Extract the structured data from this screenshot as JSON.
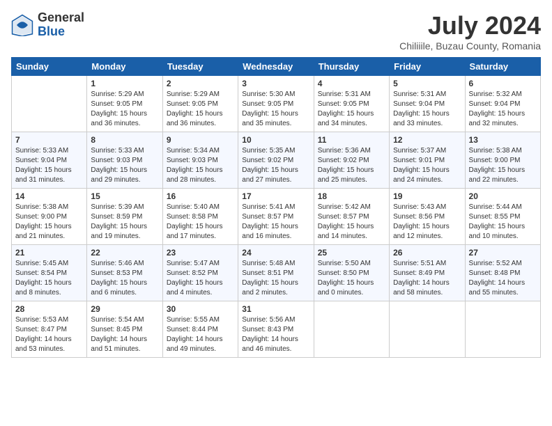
{
  "header": {
    "logo_general": "General",
    "logo_blue": "Blue",
    "month_title": "July 2024",
    "location": "Chiliiile, Buzau County, Romania"
  },
  "weekdays": [
    "Sunday",
    "Monday",
    "Tuesday",
    "Wednesday",
    "Thursday",
    "Friday",
    "Saturday"
  ],
  "weeks": [
    [
      {
        "day": "",
        "info": ""
      },
      {
        "day": "1",
        "info": "Sunrise: 5:29 AM\nSunset: 9:05 PM\nDaylight: 15 hours\nand 36 minutes."
      },
      {
        "day": "2",
        "info": "Sunrise: 5:29 AM\nSunset: 9:05 PM\nDaylight: 15 hours\nand 36 minutes."
      },
      {
        "day": "3",
        "info": "Sunrise: 5:30 AM\nSunset: 9:05 PM\nDaylight: 15 hours\nand 35 minutes."
      },
      {
        "day": "4",
        "info": "Sunrise: 5:31 AM\nSunset: 9:05 PM\nDaylight: 15 hours\nand 34 minutes."
      },
      {
        "day": "5",
        "info": "Sunrise: 5:31 AM\nSunset: 9:04 PM\nDaylight: 15 hours\nand 33 minutes."
      },
      {
        "day": "6",
        "info": "Sunrise: 5:32 AM\nSunset: 9:04 PM\nDaylight: 15 hours\nand 32 minutes."
      }
    ],
    [
      {
        "day": "7",
        "info": "Sunrise: 5:33 AM\nSunset: 9:04 PM\nDaylight: 15 hours\nand 31 minutes."
      },
      {
        "day": "8",
        "info": "Sunrise: 5:33 AM\nSunset: 9:03 PM\nDaylight: 15 hours\nand 29 minutes."
      },
      {
        "day": "9",
        "info": "Sunrise: 5:34 AM\nSunset: 9:03 PM\nDaylight: 15 hours\nand 28 minutes."
      },
      {
        "day": "10",
        "info": "Sunrise: 5:35 AM\nSunset: 9:02 PM\nDaylight: 15 hours\nand 27 minutes."
      },
      {
        "day": "11",
        "info": "Sunrise: 5:36 AM\nSunset: 9:02 PM\nDaylight: 15 hours\nand 25 minutes."
      },
      {
        "day": "12",
        "info": "Sunrise: 5:37 AM\nSunset: 9:01 PM\nDaylight: 15 hours\nand 24 minutes."
      },
      {
        "day": "13",
        "info": "Sunrise: 5:38 AM\nSunset: 9:00 PM\nDaylight: 15 hours\nand 22 minutes."
      }
    ],
    [
      {
        "day": "14",
        "info": "Sunrise: 5:38 AM\nSunset: 9:00 PM\nDaylight: 15 hours\nand 21 minutes."
      },
      {
        "day": "15",
        "info": "Sunrise: 5:39 AM\nSunset: 8:59 PM\nDaylight: 15 hours\nand 19 minutes."
      },
      {
        "day": "16",
        "info": "Sunrise: 5:40 AM\nSunset: 8:58 PM\nDaylight: 15 hours\nand 17 minutes."
      },
      {
        "day": "17",
        "info": "Sunrise: 5:41 AM\nSunset: 8:57 PM\nDaylight: 15 hours\nand 16 minutes."
      },
      {
        "day": "18",
        "info": "Sunrise: 5:42 AM\nSunset: 8:57 PM\nDaylight: 15 hours\nand 14 minutes."
      },
      {
        "day": "19",
        "info": "Sunrise: 5:43 AM\nSunset: 8:56 PM\nDaylight: 15 hours\nand 12 minutes."
      },
      {
        "day": "20",
        "info": "Sunrise: 5:44 AM\nSunset: 8:55 PM\nDaylight: 15 hours\nand 10 minutes."
      }
    ],
    [
      {
        "day": "21",
        "info": "Sunrise: 5:45 AM\nSunset: 8:54 PM\nDaylight: 15 hours\nand 8 minutes."
      },
      {
        "day": "22",
        "info": "Sunrise: 5:46 AM\nSunset: 8:53 PM\nDaylight: 15 hours\nand 6 minutes."
      },
      {
        "day": "23",
        "info": "Sunrise: 5:47 AM\nSunset: 8:52 PM\nDaylight: 15 hours\nand 4 minutes."
      },
      {
        "day": "24",
        "info": "Sunrise: 5:48 AM\nSunset: 8:51 PM\nDaylight: 15 hours\nand 2 minutes."
      },
      {
        "day": "25",
        "info": "Sunrise: 5:50 AM\nSunset: 8:50 PM\nDaylight: 15 hours\nand 0 minutes."
      },
      {
        "day": "26",
        "info": "Sunrise: 5:51 AM\nSunset: 8:49 PM\nDaylight: 14 hours\nand 58 minutes."
      },
      {
        "day": "27",
        "info": "Sunrise: 5:52 AM\nSunset: 8:48 PM\nDaylight: 14 hours\nand 55 minutes."
      }
    ],
    [
      {
        "day": "28",
        "info": "Sunrise: 5:53 AM\nSunset: 8:47 PM\nDaylight: 14 hours\nand 53 minutes."
      },
      {
        "day": "29",
        "info": "Sunrise: 5:54 AM\nSunset: 8:45 PM\nDaylight: 14 hours\nand 51 minutes."
      },
      {
        "day": "30",
        "info": "Sunrise: 5:55 AM\nSunset: 8:44 PM\nDaylight: 14 hours\nand 49 minutes."
      },
      {
        "day": "31",
        "info": "Sunrise: 5:56 AM\nSunset: 8:43 PM\nDaylight: 14 hours\nand 46 minutes."
      },
      {
        "day": "",
        "info": ""
      },
      {
        "day": "",
        "info": ""
      },
      {
        "day": "",
        "info": ""
      }
    ]
  ]
}
